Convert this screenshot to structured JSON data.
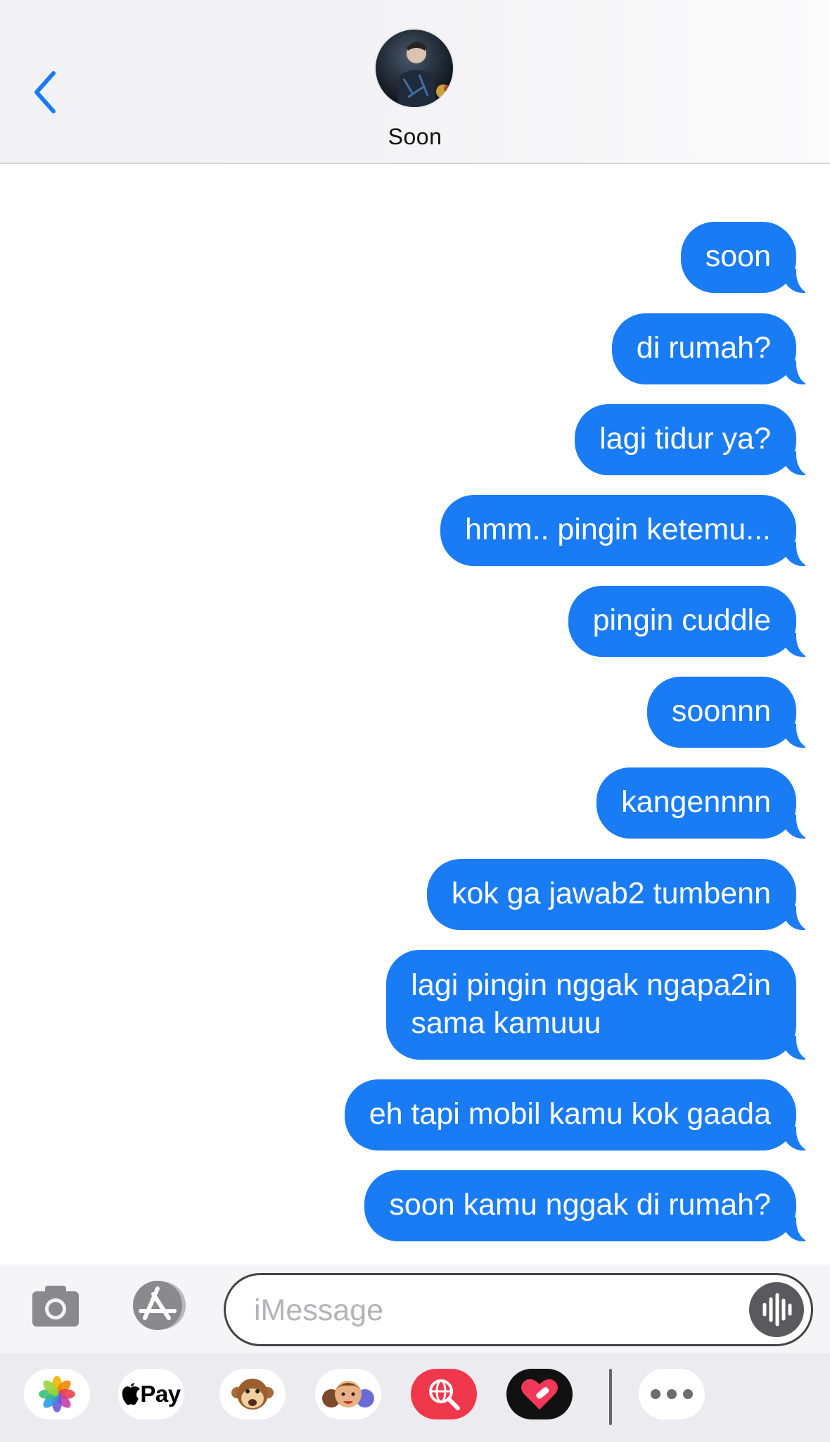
{
  "header": {
    "contact_name": "Soon"
  },
  "messages": [
    {
      "text": "soon",
      "from": "me"
    },
    {
      "text": "di rumah?",
      "from": "me"
    },
    {
      "text": "lagi tidur ya?",
      "from": "me"
    },
    {
      "text": "hmm.. pingin ketemu...",
      "from": "me"
    },
    {
      "text": "pingin cuddle",
      "from": "me"
    },
    {
      "text": "soonnn",
      "from": "me"
    },
    {
      "text": "kangennnn",
      "from": "me"
    },
    {
      "text": "kok ga jawab2 tumbenn",
      "from": "me"
    },
    {
      "text": "lagi pingin nggak ngapa2in",
      "text_line2": "sama kamuuu",
      "from": "me"
    },
    {
      "text": "eh tapi mobil kamu kok gaada",
      "from": "me"
    },
    {
      "text": "soon kamu nggak di rumah?",
      "from": "me"
    }
  ],
  "composer": {
    "placeholder": "iMessage",
    "value": ""
  },
  "apps_drawer": {
    "items": [
      {
        "name": "photos",
        "icon": "photos-icon"
      },
      {
        "name": "apple-pay",
        "icon": "apple-logo-icon",
        "label": "Pay"
      },
      {
        "name": "animoji",
        "icon": "monkey-icon"
      },
      {
        "name": "memoji",
        "icon": "memoji-icon"
      },
      {
        "name": "search-images",
        "icon": "globe-search-icon"
      },
      {
        "name": "digital-touch",
        "icon": "heart-touch-icon"
      },
      {
        "name": "more",
        "icon": "ellipsis-icon"
      }
    ]
  },
  "colors": {
    "bubble": "#1a7cf5",
    "accent": "#1a7cf5",
    "header_bg": "#f3f3f5",
    "drawer_bg": "#ececf0"
  }
}
